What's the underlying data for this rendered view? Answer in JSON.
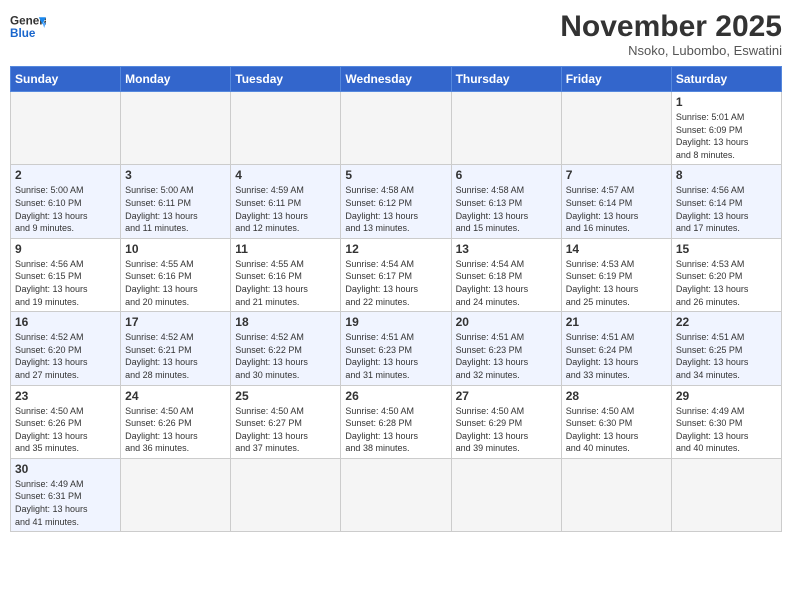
{
  "header": {
    "logo_general": "General",
    "logo_blue": "Blue",
    "month_title": "November 2025",
    "subtitle": "Nsoko, Lubombo, Eswatini"
  },
  "weekdays": [
    "Sunday",
    "Monday",
    "Tuesday",
    "Wednesday",
    "Thursday",
    "Friday",
    "Saturday"
  ],
  "weeks": [
    [
      {
        "day": "",
        "info": "",
        "empty": true
      },
      {
        "day": "",
        "info": "",
        "empty": true
      },
      {
        "day": "",
        "info": "",
        "empty": true
      },
      {
        "day": "",
        "info": "",
        "empty": true
      },
      {
        "day": "",
        "info": "",
        "empty": true
      },
      {
        "day": "",
        "info": "",
        "empty": true
      },
      {
        "day": "1",
        "info": "Sunrise: 5:01 AM\nSunset: 6:09 PM\nDaylight: 13 hours\nand 8 minutes."
      }
    ],
    [
      {
        "day": "2",
        "info": "Sunrise: 5:00 AM\nSunset: 6:10 PM\nDaylight: 13 hours\nand 9 minutes."
      },
      {
        "day": "3",
        "info": "Sunrise: 5:00 AM\nSunset: 6:11 PM\nDaylight: 13 hours\nand 11 minutes."
      },
      {
        "day": "4",
        "info": "Sunrise: 4:59 AM\nSunset: 6:11 PM\nDaylight: 13 hours\nand 12 minutes."
      },
      {
        "day": "5",
        "info": "Sunrise: 4:58 AM\nSunset: 6:12 PM\nDaylight: 13 hours\nand 13 minutes."
      },
      {
        "day": "6",
        "info": "Sunrise: 4:58 AM\nSunset: 6:13 PM\nDaylight: 13 hours\nand 15 minutes."
      },
      {
        "day": "7",
        "info": "Sunrise: 4:57 AM\nSunset: 6:14 PM\nDaylight: 13 hours\nand 16 minutes."
      },
      {
        "day": "8",
        "info": "Sunrise: 4:56 AM\nSunset: 6:14 PM\nDaylight: 13 hours\nand 17 minutes."
      }
    ],
    [
      {
        "day": "9",
        "info": "Sunrise: 4:56 AM\nSunset: 6:15 PM\nDaylight: 13 hours\nand 19 minutes."
      },
      {
        "day": "10",
        "info": "Sunrise: 4:55 AM\nSunset: 6:16 PM\nDaylight: 13 hours\nand 20 minutes."
      },
      {
        "day": "11",
        "info": "Sunrise: 4:55 AM\nSunset: 6:16 PM\nDaylight: 13 hours\nand 21 minutes."
      },
      {
        "day": "12",
        "info": "Sunrise: 4:54 AM\nSunset: 6:17 PM\nDaylight: 13 hours\nand 22 minutes."
      },
      {
        "day": "13",
        "info": "Sunrise: 4:54 AM\nSunset: 6:18 PM\nDaylight: 13 hours\nand 24 minutes."
      },
      {
        "day": "14",
        "info": "Sunrise: 4:53 AM\nSunset: 6:19 PM\nDaylight: 13 hours\nand 25 minutes."
      },
      {
        "day": "15",
        "info": "Sunrise: 4:53 AM\nSunset: 6:20 PM\nDaylight: 13 hours\nand 26 minutes."
      }
    ],
    [
      {
        "day": "16",
        "info": "Sunrise: 4:52 AM\nSunset: 6:20 PM\nDaylight: 13 hours\nand 27 minutes."
      },
      {
        "day": "17",
        "info": "Sunrise: 4:52 AM\nSunset: 6:21 PM\nDaylight: 13 hours\nand 28 minutes."
      },
      {
        "day": "18",
        "info": "Sunrise: 4:52 AM\nSunset: 6:22 PM\nDaylight: 13 hours\nand 30 minutes."
      },
      {
        "day": "19",
        "info": "Sunrise: 4:51 AM\nSunset: 6:23 PM\nDaylight: 13 hours\nand 31 minutes."
      },
      {
        "day": "20",
        "info": "Sunrise: 4:51 AM\nSunset: 6:23 PM\nDaylight: 13 hours\nand 32 minutes."
      },
      {
        "day": "21",
        "info": "Sunrise: 4:51 AM\nSunset: 6:24 PM\nDaylight: 13 hours\nand 33 minutes."
      },
      {
        "day": "22",
        "info": "Sunrise: 4:51 AM\nSunset: 6:25 PM\nDaylight: 13 hours\nand 34 minutes."
      }
    ],
    [
      {
        "day": "23",
        "info": "Sunrise: 4:50 AM\nSunset: 6:26 PM\nDaylight: 13 hours\nand 35 minutes."
      },
      {
        "day": "24",
        "info": "Sunrise: 4:50 AM\nSunset: 6:26 PM\nDaylight: 13 hours\nand 36 minutes."
      },
      {
        "day": "25",
        "info": "Sunrise: 4:50 AM\nSunset: 6:27 PM\nDaylight: 13 hours\nand 37 minutes."
      },
      {
        "day": "26",
        "info": "Sunrise: 4:50 AM\nSunset: 6:28 PM\nDaylight: 13 hours\nand 38 minutes."
      },
      {
        "day": "27",
        "info": "Sunrise: 4:50 AM\nSunset: 6:29 PM\nDaylight: 13 hours\nand 39 minutes."
      },
      {
        "day": "28",
        "info": "Sunrise: 4:50 AM\nSunset: 6:30 PM\nDaylight: 13 hours\nand 40 minutes."
      },
      {
        "day": "29",
        "info": "Sunrise: 4:49 AM\nSunset: 6:30 PM\nDaylight: 13 hours\nand 40 minutes."
      }
    ],
    [
      {
        "day": "30",
        "info": "Sunrise: 4:49 AM\nSunset: 6:31 PM\nDaylight: 13 hours\nand 41 minutes."
      },
      {
        "day": "",
        "info": "",
        "empty": true
      },
      {
        "day": "",
        "info": "",
        "empty": true
      },
      {
        "day": "",
        "info": "",
        "empty": true
      },
      {
        "day": "",
        "info": "",
        "empty": true
      },
      {
        "day": "",
        "info": "",
        "empty": true
      },
      {
        "day": "",
        "info": "",
        "empty": true
      }
    ]
  ]
}
